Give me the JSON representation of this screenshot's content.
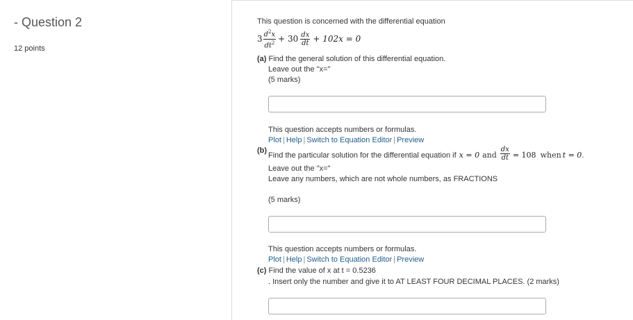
{
  "question": {
    "title_prefix": "- ",
    "title": "Question 2",
    "points": "12 points"
  },
  "intro": "This question is concerned with the differential equation",
  "equation": {
    "coef1": "3",
    "frac1_num": "d",
    "frac1_num_sup": "2",
    "frac1_num_var": "x",
    "frac1_den": "dt",
    "frac1_den_sup": "2",
    "plus1": "+ 30",
    "frac2_num": "dx",
    "frac2_den": "dt",
    "rest": "+ 102x = 0"
  },
  "part_a": {
    "label": "(a)",
    "text": "Find the general solution of this differential equation.",
    "note": "Leave out the \"x=\"",
    "marks": "(5 marks)",
    "input_value": "",
    "accepts": "This question accepts numbers or formulas.",
    "links": [
      "Plot",
      "Help",
      "Switch to Equation Editor",
      "Preview"
    ]
  },
  "part_b": {
    "label": "(b)",
    "text": "Find the particular solution for the differential equation if",
    "cond1": "x = 0",
    "and_word": "and",
    "frac_num": "dx",
    "frac_den": "dt",
    "cond2": "= 108",
    "when_word": "when",
    "cond3": "t = 0",
    "end": ".",
    "note1": "Leave out the \"x=\"",
    "note2": "Leave any numbers, which are not whole numbers, as FRACTIONS",
    "marks": "(5 marks)",
    "input_value": "",
    "accepts": "This question accepts numbers or formulas.",
    "links": [
      "Plot",
      "Help",
      "Switch to Equation Editor",
      "Preview"
    ]
  },
  "part_c": {
    "label": "(c)",
    "text": "Find the value of x at t = 0.5236",
    "note": ". Insert only the number and give it to AT LEAST FOUR DECIMAL PLACES. (2 marks)",
    "input_value": ""
  },
  "colors": {
    "link": "#1f5e8c",
    "border": "#dddddd",
    "text": "#333333"
  }
}
